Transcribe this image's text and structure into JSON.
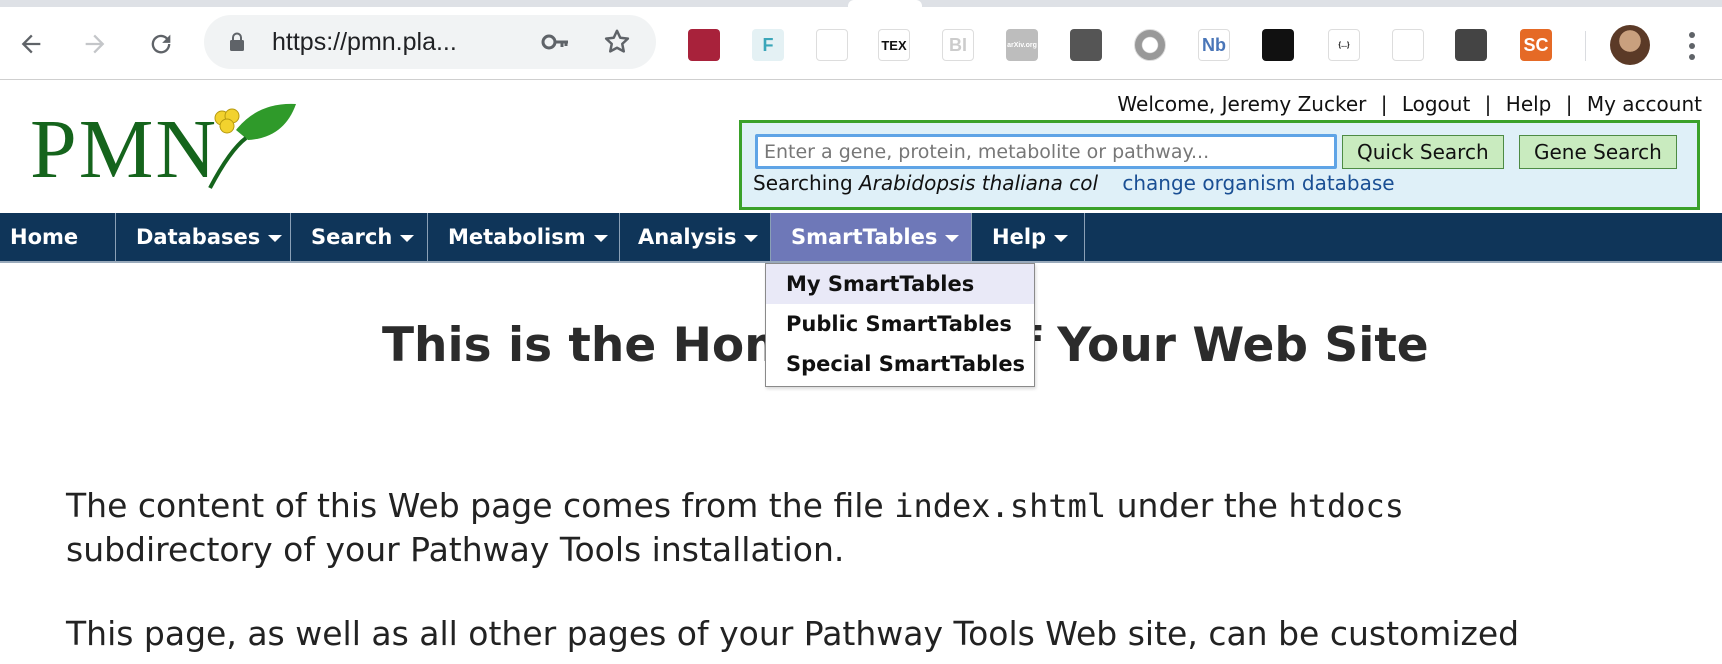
{
  "browser": {
    "url": "https://pmn.pla...",
    "extensions": [
      {
        "name": "mendeley-icon",
        "label": "",
        "bg": "#a8223b",
        "fg": "#ffffff"
      },
      {
        "name": "f-icon",
        "label": "F",
        "bg": "#e4f1f4",
        "fg": "#3aa6b9"
      },
      {
        "name": "document-icon",
        "label": "",
        "bg": "#ffffff",
        "fg": "#666666"
      },
      {
        "name": "tex-icon",
        "label": "TEX",
        "bg": "#ffffff",
        "fg": "#111111"
      },
      {
        "name": "bi-icon",
        "label": "BI",
        "bg": "#ffffff",
        "fg": "#cccccc"
      },
      {
        "name": "arxiv-icon",
        "label": "arXiv.org",
        "bg": "#bdbdbd",
        "fg": "#ffffff"
      },
      {
        "name": "github-icon",
        "label": "",
        "bg": "#555555",
        "fg": "#ffffff"
      },
      {
        "name": "circle-icon",
        "label": "",
        "bg": "#ffffff",
        "fg": "#999999"
      },
      {
        "name": "nb-icon",
        "label": "Nb",
        "bg": "#ffffff",
        "fg": "#4a76b8"
      },
      {
        "name": "lock-icon",
        "label": "",
        "bg": "#111111",
        "fg": "#ffffff"
      },
      {
        "name": "braces-icon",
        "label": "{...}",
        "bg": "#ffffff",
        "fg": "#111111"
      },
      {
        "name": "speech-bubble-icon",
        "label": "",
        "bg": "#ffffff",
        "fg": "#cccccc"
      },
      {
        "name": "lightbulb-icon",
        "label": "",
        "bg": "#444444",
        "fg": "#ffffff"
      },
      {
        "name": "sc-icon",
        "label": "SC",
        "bg": "#e56a26",
        "fg": "#ffffff"
      }
    ]
  },
  "header": {
    "logo_text": "PMN",
    "welcome": "Welcome, Jeremy Zucker",
    "links": [
      "Logout",
      "Help",
      "My account"
    ]
  },
  "search": {
    "placeholder": "Enter a gene, protein, metabolite or pathway...",
    "value": "",
    "quick_search_label": "Quick Search",
    "gene_search_label": "Gene Search",
    "searching_prefix": "Searching",
    "organism": "Arabidopsis thaliana col",
    "change_link": "change organism database"
  },
  "nav": {
    "items": [
      {
        "label": "Home",
        "has_menu": false
      },
      {
        "label": "Databases",
        "has_menu": true
      },
      {
        "label": "Search",
        "has_menu": true
      },
      {
        "label": "Metabolism",
        "has_menu": true
      },
      {
        "label": "Analysis",
        "has_menu": true
      },
      {
        "label": "SmartTables",
        "has_menu": true
      },
      {
        "label": "Help",
        "has_menu": true
      }
    ],
    "active": "SmartTables",
    "dropdown": [
      "My SmartTables",
      "Public SmartTables",
      "Special SmartTables"
    ]
  },
  "content": {
    "title": "This is the Home Page of Your Web Site",
    "p1_a": "The content of this Web page comes from the file",
    "p1_file": "index.shtml",
    "p1_b": "under the",
    "p1_dir": "htdocs",
    "p1_c": "subdirectory of your Pathway Tools installation.",
    "p2": "This page, as well as all other pages of your Pathway Tools Web site, can be customized"
  },
  "colors": {
    "nav_bg": "#0f3559",
    "nav_active": "#6e78b8",
    "search_border": "#3aa12a",
    "search_bg": "#dff0f8",
    "button_bg": "#c9ebbf",
    "link": "#1a4f94",
    "logo_green": "#15641c"
  }
}
